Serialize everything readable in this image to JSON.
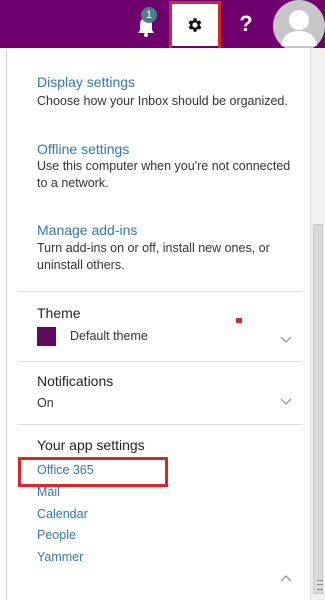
{
  "header": {
    "notification_count": "1",
    "help_label": "?"
  },
  "settings": {
    "display": {
      "title": "Display settings",
      "description": "Choose how your Inbox should be organized."
    },
    "offline": {
      "title": "Offline settings",
      "description": "Use this computer when you're not connected to a network."
    },
    "addins": {
      "title": "Manage add-ins",
      "description": "Turn add-ins on or off, install new ones, or uninstall others."
    },
    "theme": {
      "title": "Theme",
      "value": "Default theme",
      "swatch_color": "#5e0a5a"
    },
    "notifications": {
      "title": "Notifications",
      "value": "On"
    },
    "app_settings": {
      "title": "Your app settings",
      "items": [
        "Office 365",
        "Mail",
        "Calendar",
        "People",
        "Yammer"
      ]
    }
  },
  "colors": {
    "topbar": "#70006e",
    "link": "#3576a8",
    "highlight": "#d8262c"
  }
}
